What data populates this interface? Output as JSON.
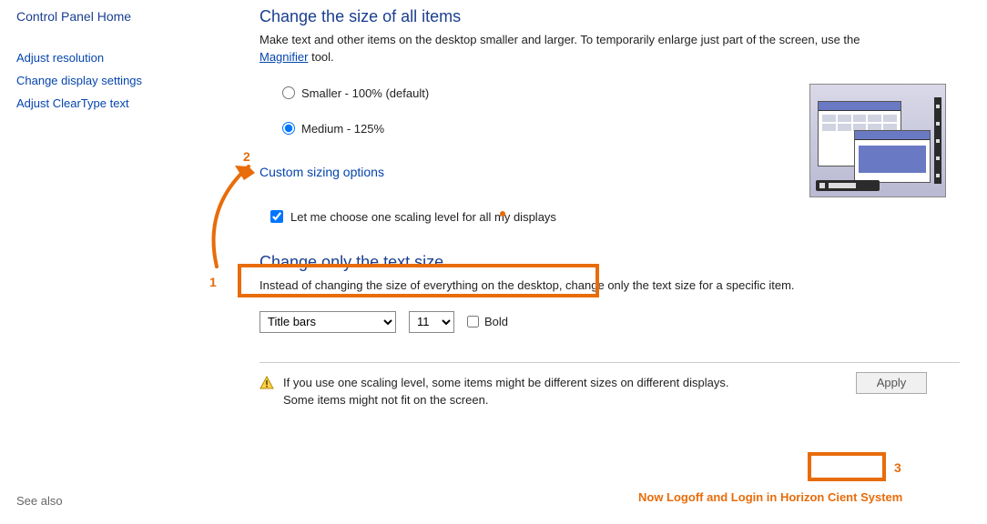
{
  "sidebar": {
    "title": "Control Panel Home",
    "links": [
      "Adjust resolution",
      "Change display settings",
      "Adjust ClearType text"
    ],
    "see_also": "See also"
  },
  "section1": {
    "title": "Change the size of all items",
    "desc_pre": "Make text and other items on the desktop smaller and larger. To temporarily enlarge just part of the screen, use the ",
    "magnifier": "Magnifier",
    "desc_post": " tool.",
    "radio_smaller": "Smaller - 100% (default)",
    "radio_medium": "Medium - 125%",
    "custom_link": "Custom sizing options",
    "checkbox_label": "Let me choose one scaling level for all my displays"
  },
  "section2": {
    "title": "Change only the text size",
    "desc": "Instead of changing the size of everything on the desktop, change only the text size for a specific item.",
    "item_select": "Title bars",
    "size_select": "11",
    "bold_label": "Bold"
  },
  "footer": {
    "warn_line1": "If you use one scaling level, some items might be different sizes on different displays.",
    "warn_line2": "Some items might not fit on the screen.",
    "apply": "Apply"
  },
  "annotations": {
    "n1": "1",
    "n2": "2",
    "n3": "3",
    "msg": "Now Logoff and Login in Horizon Cient System"
  }
}
